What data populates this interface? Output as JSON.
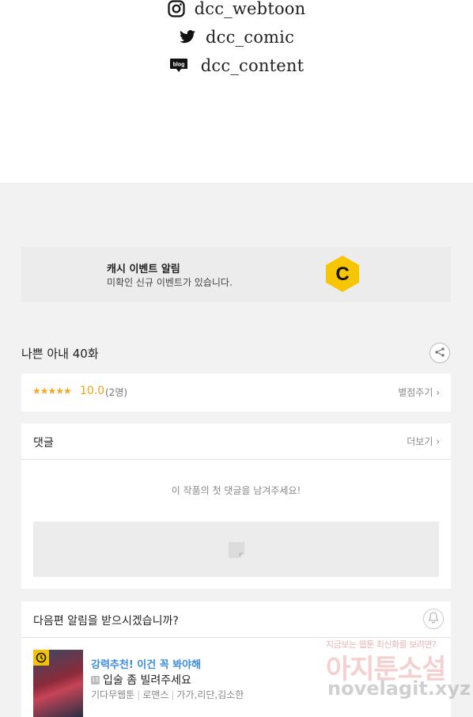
{
  "social": [
    {
      "icon": "instagram-icon",
      "label": "dcc_webtoon"
    },
    {
      "icon": "twitter-icon",
      "label": "dcc_comic"
    },
    {
      "icon": "blog-icon",
      "label": "dcc_content"
    }
  ],
  "cash_event": {
    "title": "캐시 이벤트 알림",
    "subtitle": "미확인 신규 이벤트가 있습니다.",
    "logo_letter": "C",
    "logo_color": "#f7c600"
  },
  "episode": {
    "title": "나쁜 아내 40화"
  },
  "rating": {
    "stars": "★★★★★",
    "score": "10.0",
    "count": "(2명)",
    "rate_link": "별점주기 ›",
    "star_color": "#f5a623"
  },
  "comments": {
    "title": "댓글",
    "more_link": "더보기 ›",
    "empty_message": "이 작품의 첫 댓글을 남겨주세요!"
  },
  "notify": {
    "title": "다음편 알림을 받으시겠습니까?"
  },
  "recommend": {
    "tag": "강력추천! 이건 꼭 봐야해",
    "age_badge": "15",
    "title": "입술 좀 빌려주세요",
    "platform": "기다무웹툰",
    "genre": "로맨스",
    "authors": "가가,리단,김소한",
    "tag_color": "#3b8de0"
  },
  "watermark": {
    "line1": "지금보는 웹툰 최신화를 보려면?",
    "line2": "아지툰소설",
    "line3": "novelagit.xyz"
  }
}
